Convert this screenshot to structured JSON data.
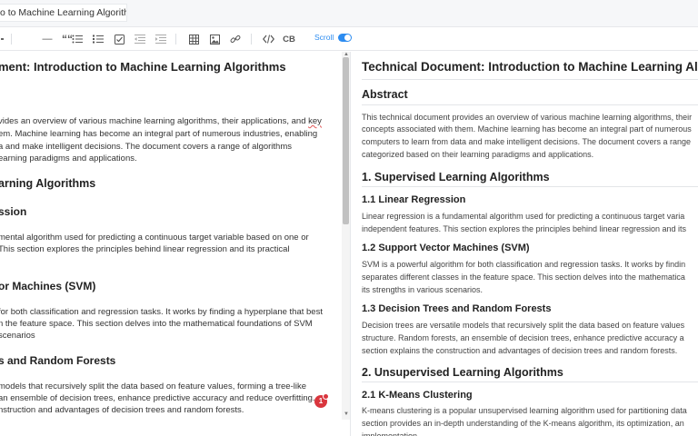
{
  "header": {
    "title_value": "o to Machine Learning Algorithms"
  },
  "toolbar": {
    "scroll_label": "Scroll",
    "cb_label": "CB",
    "dash_label": "—",
    "quote_label": "““"
  },
  "editor": {
    "lines": [
      "ment: Introduction to Machine Learning Algorithms",
      "vides an overview of various machine learning algorithms, their applications, and",
      "key",
      "em. Machine learning has become an integral part of numerous industries, enabling",
      "a and make intelligent decisions. The document covers a range of algorithms",
      "earning paradigms and applications.",
      "arning Algorithms",
      "ssion",
      "mental algorithm used for predicting a continuous target variable based on one or",
      "This section explores the principles behind linear regression and its practical",
      "or Machines (SVM)",
      "for both classification and regression tasks. It works by finding a hyperplane that best",
      "n the feature space. This section delves into the mathematical foundations of SVM",
      "scenarios",
      "s and Random Forests",
      "models that recursively split the data based on feature values, forming a tree-like",
      "an ensemble of decision trees, enhance predictive accuracy and reduce overfitting.",
      "nstruction and advantages of decision trees and random forests."
    ]
  },
  "preview": {
    "title": "Technical Document: Introduction to Machine Learning Algorithms",
    "abstract_heading": "Abstract",
    "abstract_lines": [
      "This technical document provides an overview of various machine learning algorithms, their",
      "concepts associated with them. Machine learning has become an integral part of numerous",
      "computers to learn from data and make intelligent decisions. The document covers a range",
      "categorized based on their learning paradigms and applications."
    ],
    "s1_heading": "1. Supervised Learning Algorithms",
    "s11_heading": "1.1 Linear Regression",
    "s11_lines": [
      "Linear regression is a fundamental algorithm used for predicting a continuous target varia",
      "independent features. This section explores the principles behind linear regression and its"
    ],
    "s12_heading": "1.2 Support Vector Machines (SVM)",
    "s12_lines": [
      "SVM is a powerful algorithm for both classification and regression tasks. It works by findin",
      "separates different classes in the feature space. This section delves into the mathematica",
      "its strengths in various scenarios."
    ],
    "s13_heading": "1.3 Decision Trees and Random Forests",
    "s13_lines": [
      "Decision trees are versatile models that recursively split the data based on feature values",
      "structure. Random forests, an ensemble of decision trees, enhance predictive accuracy a",
      "section explains the construction and advantages of decision trees and random forests."
    ],
    "s2_heading": "2. Unsupervised Learning Algorithms",
    "s21_heading": "2.1 K-Means Clustering",
    "s21_lines": [
      "K-means clustering is a popular unsupervised learning algorithm used for partitioning data",
      "section provides an in-depth understanding of the K-means algorithm, its optimization, an",
      "implementation"
    ]
  },
  "badge": {
    "label": "1"
  },
  "colors": {
    "accent": "#2d8cf0",
    "badge": "#d9363e"
  }
}
